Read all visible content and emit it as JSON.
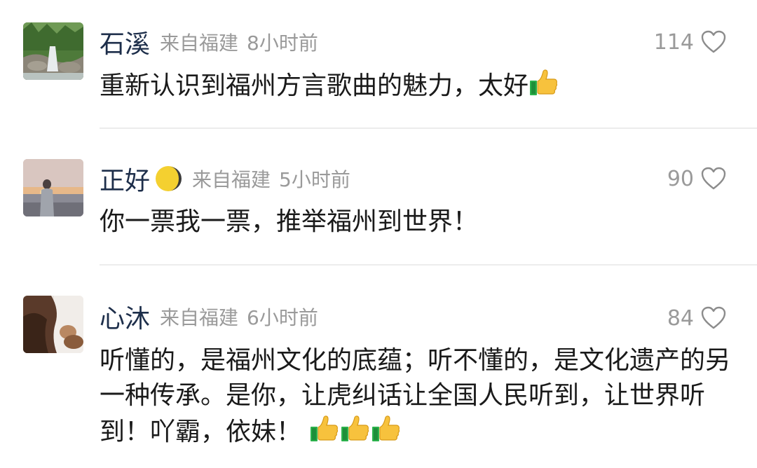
{
  "comments": [
    {
      "username": "石溪",
      "location": "来自福建",
      "time": "8小时前",
      "likes": "114",
      "text": "重新认识到福州方言歌曲的魅力，太好",
      "thumbs": 1,
      "avatar_icon": "waterfall-landscape-avatar"
    },
    {
      "username": "正好",
      "location": "来自福建",
      "time": "5小时前",
      "likes": "90",
      "text": "你一票我一票，推举福州到世界！",
      "thumbs": 0,
      "name_emoji": "crescent-moon-icon",
      "avatar_icon": "sunset-girl-avatar"
    },
    {
      "username": "心沐",
      "location": "来自福建",
      "time": "6小时前",
      "likes": "84",
      "text": "听懂的，是福州文化的底蕴；听不懂的，是文化遗产的另一种传承。是你，让虎纠话让全国人民听到，让世界听到！吖霸，依妹！",
      "thumbs": 3,
      "avatar_icon": "silhouette-portrait-avatar"
    }
  ],
  "colors": {
    "username": "#1d2e4a",
    "meta": "#9a9a9a",
    "text": "#1a1a1a",
    "divider": "#ececec"
  }
}
